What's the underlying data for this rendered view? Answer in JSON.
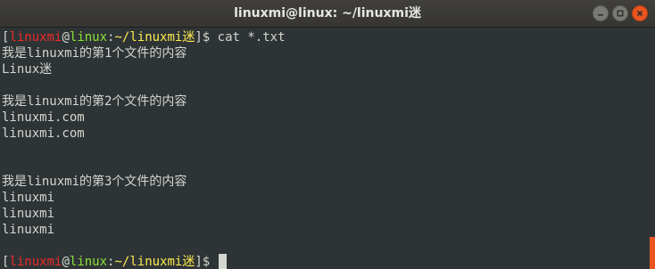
{
  "window": {
    "title": "linuxmi@linux: ~/linuxmi迷"
  },
  "prompt": {
    "open": "[",
    "user": "linuxmi",
    "at": "@",
    "host": "linux",
    "colon": ":",
    "path": "~/linuxmi迷",
    "close": "]$ "
  },
  "terminal": {
    "command": "cat *.txt",
    "output": [
      "我是linuxmi的第1个文件的内容",
      "Linux迷",
      "",
      "我是linuxmi的第2个文件的内容",
      "linuxmi.com",
      "linuxmi.com",
      "",
      "",
      "我是linuxmi的第3个文件的内容",
      "linuxmi",
      "linuxmi",
      "linuxmi",
      ""
    ]
  },
  "colors": {
    "accent": "#e95420",
    "background": "#2e3436",
    "user": "#ef2929",
    "host": "#8ae234",
    "path": "#fce94f",
    "text": "#d3d7cf"
  },
  "icons": {
    "minimize": "minimize-icon",
    "maximize": "maximize-icon",
    "close": "close-icon"
  }
}
